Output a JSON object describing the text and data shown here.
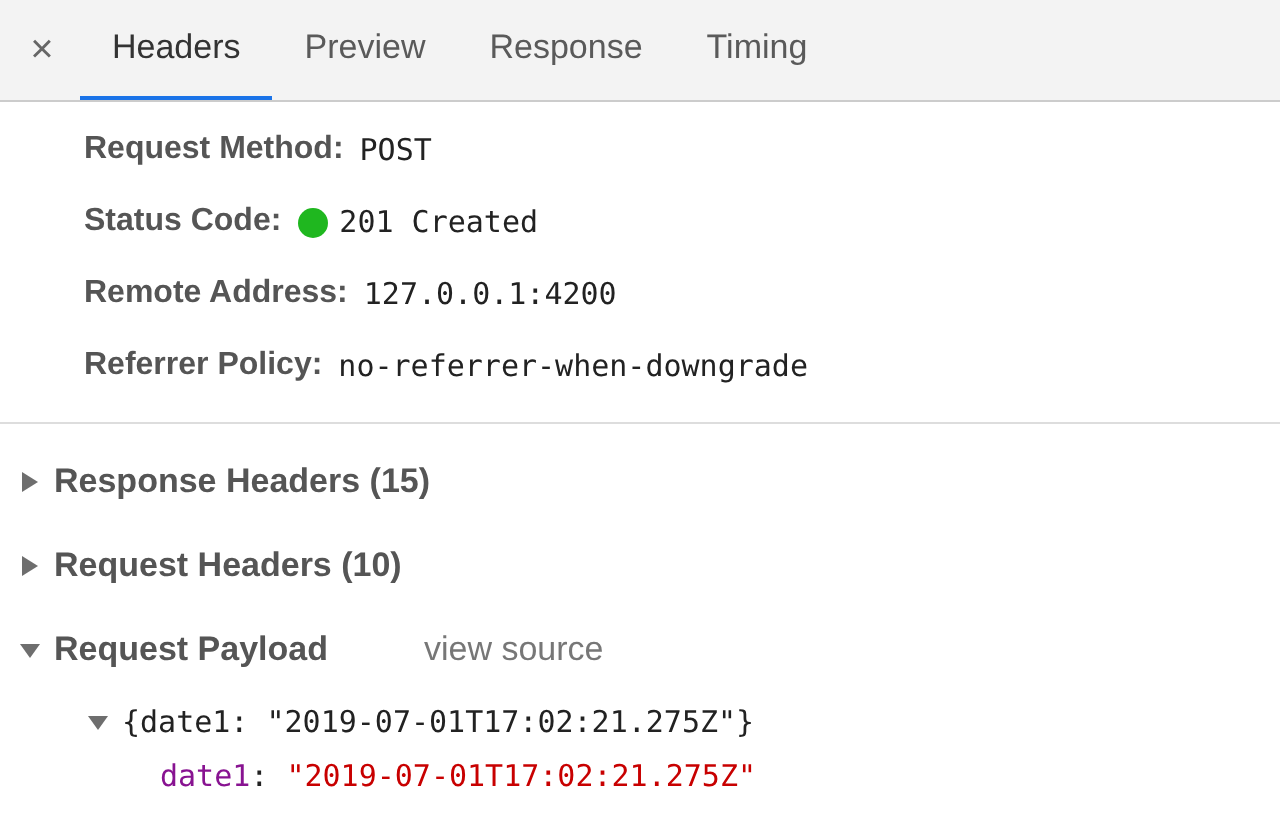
{
  "close_button": "×",
  "tabs": [
    {
      "label": "Headers",
      "selected": true
    },
    {
      "label": "Preview",
      "selected": false
    },
    {
      "label": "Response",
      "selected": false
    },
    {
      "label": "Timing",
      "selected": false
    }
  ],
  "general": [
    {
      "label": "Request Method:",
      "value": "POST"
    },
    {
      "label": "Status Code:",
      "value": "201 Created",
      "color": "#1fb71f"
    },
    {
      "label": "Remote Address:",
      "value": "127.0.0.1:4200"
    },
    {
      "label": "Referrer Policy:",
      "value": "no-referrer-when-downgrade"
    }
  ],
  "sections": [
    {
      "title": "Response Headers (15)",
      "expanded": false
    },
    {
      "title": "Request Headers (10)",
      "expanded": false
    },
    {
      "title": "Request Payload",
      "expanded": true,
      "link": "view source"
    }
  ],
  "payload": {
    "summary": "{date1: \"2019-07-01T17:02:21.275Z\"}",
    "expanded": true,
    "properties": [
      {
        "key": "date1",
        "separator": ":",
        "value": "\"2019-07-01T17:02:21.275Z\""
      }
    ]
  }
}
